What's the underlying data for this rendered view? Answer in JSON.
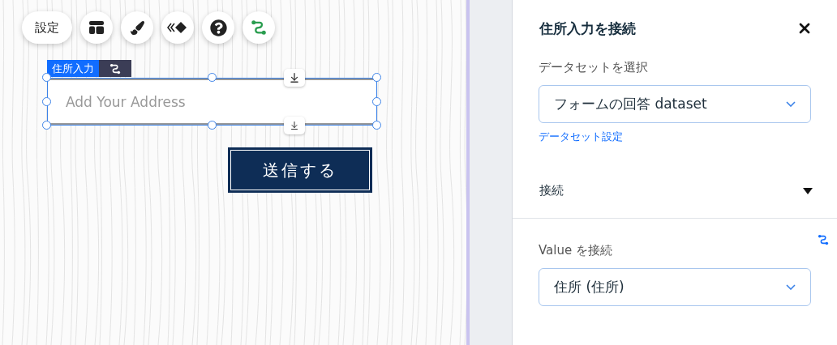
{
  "toolbar": {
    "buttons": [
      {
        "kind": "text",
        "label": "設定"
      },
      {
        "kind": "layout"
      },
      {
        "kind": "design"
      },
      {
        "kind": "animation"
      },
      {
        "kind": "help"
      },
      {
        "kind": "connect"
      }
    ]
  },
  "element": {
    "tag": "住所入力",
    "placeholder": "Add Your Address",
    "selected": true
  },
  "submit_button": {
    "label": "送信する"
  },
  "panel": {
    "title": "住所入力を接続",
    "dataset_label": "データセットを選択",
    "dataset_value": "フォームの回答 dataset",
    "dataset_settings_link": "データセット設定",
    "section": {
      "title": "接続",
      "expanded": true
    },
    "value_label": "Value を接続",
    "value_select": "住所 (住所)"
  }
}
